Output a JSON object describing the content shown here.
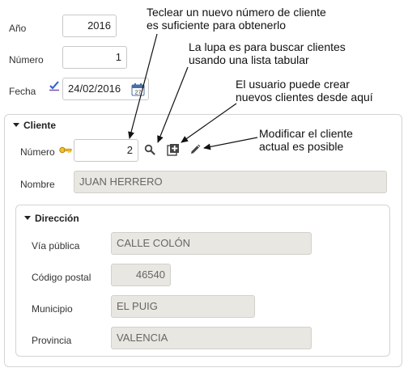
{
  "header": {
    "year_label": "Año",
    "year_value": "2016",
    "number_label": "Número",
    "number_value": "1",
    "date_label": "Fecha",
    "date_value": "24/02/2016"
  },
  "cliente": {
    "title": "Cliente",
    "number_label": "Número",
    "number_value": "2",
    "name_label": "Nombre",
    "name_value": "JUAN HERRERO"
  },
  "direccion": {
    "title": "Dirección",
    "via_label": "Vía pública",
    "via_value": "CALLE COLÓN",
    "cp_label": "Código postal",
    "cp_value": "46540",
    "municipio_label": "Municipio",
    "municipio_value": "EL PUIG",
    "provincia_label": "Provincia",
    "provincia_value": "VALENCIA"
  },
  "annotations": {
    "a1_line1": "Teclear un nuevo número de cliente",
    "a1_line2": "es suficiente para obtenerlo",
    "a2_line1": "La lupa es para buscar clientes",
    "a2_line2": "usando una lista tabular",
    "a3_line1": "El usuario puede crear",
    "a3_line2": "nuevos clientes desde aquí",
    "a4_line1": "Modificar el cliente",
    "a4_line2": "actual es posible"
  },
  "icons": {
    "key": "key-icon",
    "search": "search-icon",
    "add": "add-icon",
    "edit": "pencil-icon",
    "calendar": "calendar-icon",
    "date_mode": "date-mode-icon"
  }
}
